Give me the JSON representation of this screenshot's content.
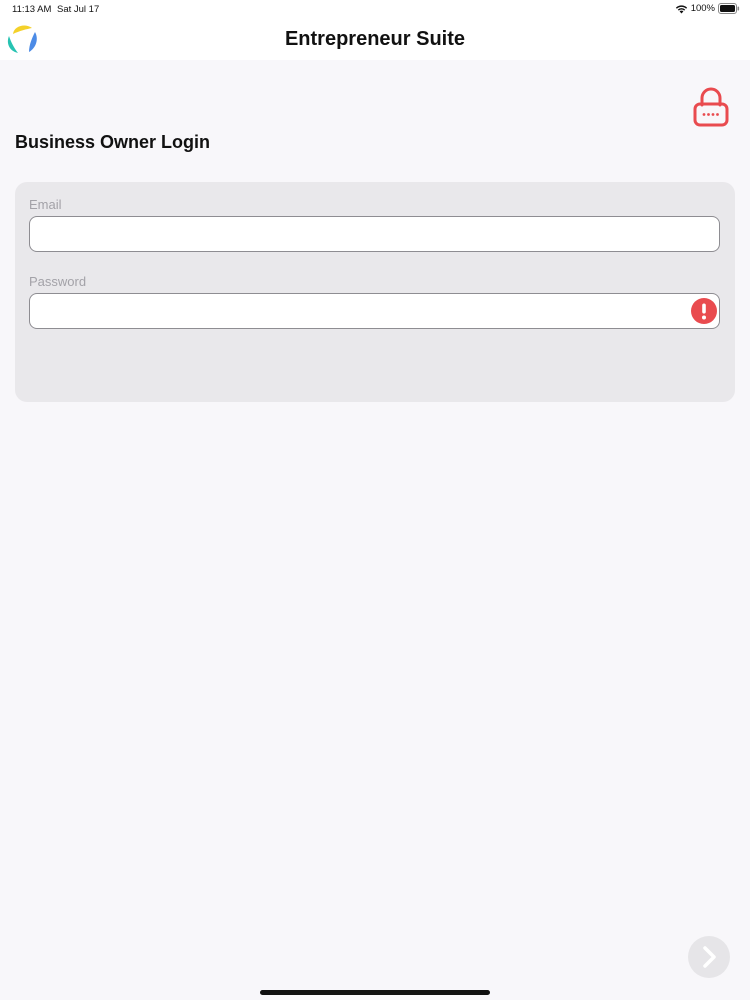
{
  "status_bar": {
    "time": "11:13 AM",
    "date": "Sat Jul 17",
    "battery": "100%",
    "icons": [
      "wifi-icon",
      "battery-icon"
    ]
  },
  "nav": {
    "title": "Entrepreneur Suite",
    "logo_icon": "app-logo-icon"
  },
  "page": {
    "title": "Business Owner Login",
    "lock_icon": "lock-icon"
  },
  "form": {
    "email_label": "Email",
    "email_value": "",
    "password_label": "Password",
    "password_value": "",
    "error_icon": "exclamation-circle-icon"
  },
  "actions": {
    "next_icon": "chevron-right-icon"
  },
  "colors": {
    "accent_red": "#e94b4f",
    "card_bg": "#e9e8eb",
    "background": "#f8f7fa",
    "label_gray": "#a3a2a8"
  }
}
